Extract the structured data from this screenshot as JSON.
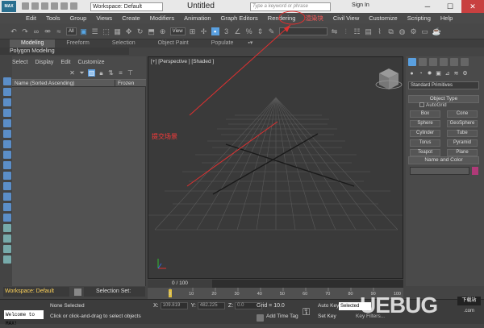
{
  "titlebar": {
    "logo": "MAX",
    "workspace": "Workspace: Default",
    "app_title": "Untitled",
    "search_placeholder": "Type a keyword or phrase",
    "sign_in": "Sign In",
    "min": "─",
    "max": "☐",
    "close": "✕"
  },
  "menubar": [
    "Edit",
    "Tools",
    "Group",
    "Views",
    "Create",
    "Modifiers",
    "Animation",
    "Graph Editors",
    "Rendering",
    "渲染块",
    "Civil View",
    "Customize",
    "Scripting",
    "Help"
  ],
  "toolbar": {
    "filter": "All",
    "view": "View"
  },
  "ribbon": {
    "tabs": [
      "Modeling",
      "Freeform",
      "Selection",
      "Object Paint",
      "Populate"
    ],
    "subtitle": "Polygon Modeling"
  },
  "explorer": {
    "menu": [
      "Select",
      "Display",
      "Edit",
      "Customize"
    ],
    "col_name": "Name (Sorted Ascending)",
    "col_frozen": "Frozen"
  },
  "viewport": {
    "label": "[+] [Perspective ] [Shaded ]",
    "annotation": "在此处点击渲染块，提交场景"
  },
  "cmdpanel": {
    "dropdown": "Standard Primitives",
    "object_type": "Object Type",
    "autogrid": "AutoGrid",
    "buttons": [
      "Box",
      "Cone",
      "Sphere",
      "GeoSphere",
      "Cylinder",
      "Tube",
      "Torus",
      "Pyramid",
      "Teapot",
      "Plane"
    ],
    "name_color": "Name and Color"
  },
  "timeline": {
    "counter": "0 / 100",
    "ticks": [
      "0",
      "10",
      "20",
      "30",
      "40",
      "50",
      "60",
      "70",
      "80",
      "90",
      "100"
    ]
  },
  "status": {
    "workspace": "Workspace: Default",
    "selection_set": "Selection Set:",
    "maxscript": "Welcome to MAX!",
    "none_selected": "None Selected",
    "hint": "Click or click-and-drag to select objects",
    "x_label": "X:",
    "x_val": "109.819",
    "y_label": "Y:",
    "y_val": "482.225",
    "z_label": "Z:",
    "z_val": "0.0",
    "grid": "Grid = 10.0",
    "add_time_tag": "Add Time Tag",
    "auto_key": "Auto Key",
    "set_key": "Set Key",
    "selected": "Selected",
    "key_filters": "Key Filters..."
  },
  "watermark": {
    "text": "UEBUG",
    "sub": "下载站",
    "com": ".com"
  },
  "colors": {
    "accent": "#5aa0e0",
    "annotation": "#ff3a3a",
    "swatch": "#b03a78"
  }
}
